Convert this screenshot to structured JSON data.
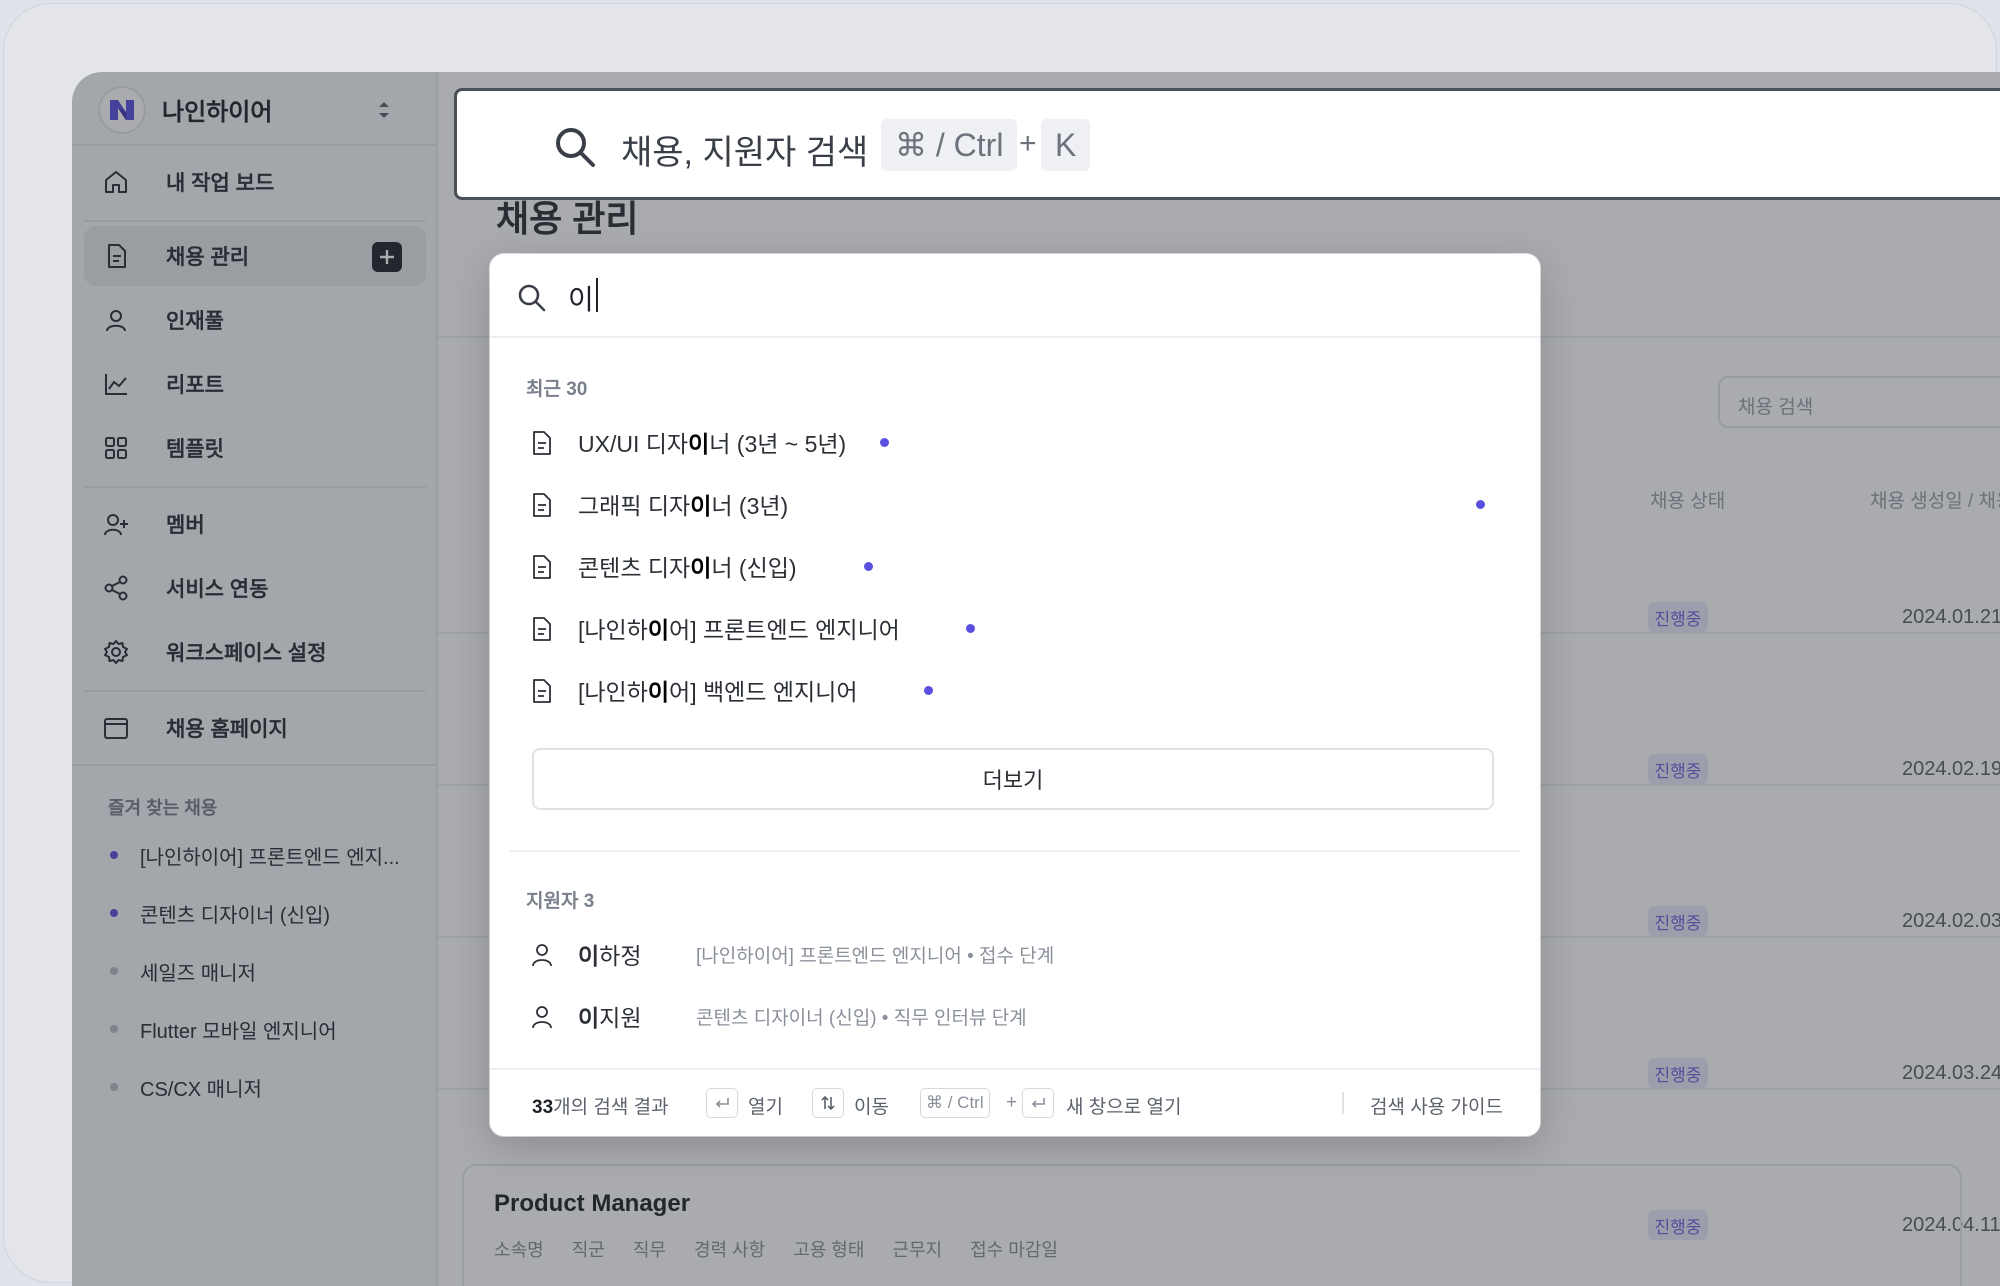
{
  "workspace": {
    "name": "나인하이어"
  },
  "sidebar": {
    "items": [
      {
        "label": "내 작업 보드",
        "icon": "home-icon"
      },
      {
        "label": "채용 관리",
        "icon": "document-icon"
      },
      {
        "label": "인재풀",
        "icon": "person-icon"
      },
      {
        "label": "리포트",
        "icon": "chart-icon"
      },
      {
        "label": "템플릿",
        "icon": "grid-icon"
      },
      {
        "label": "멤버",
        "icon": "add-user-icon"
      },
      {
        "label": "서비스 연동",
        "icon": "share-icon"
      },
      {
        "label": "워크스페이스 설정",
        "icon": "gear-icon"
      },
      {
        "label": "채용 홈페이지",
        "icon": "browser-icon"
      }
    ],
    "favorites_title": "즐겨 찾는 채용",
    "favorites": [
      {
        "label": "[나인하이어] 프론트엔드 엔지...",
        "color": "#5b4fe0"
      },
      {
        "label": "콘텐츠 디자이너 (신입)",
        "color": "#5b4fe0"
      },
      {
        "label": "세일즈 매니저",
        "color": "#b9bdc4"
      },
      {
        "label": "Flutter 모바일 엔지니어",
        "color": "#b9bdc4"
      },
      {
        "label": "CS/CX 매니저",
        "color": "#b9bdc4"
      }
    ]
  },
  "main": {
    "page_title": "채용 관리",
    "search_placeholder": "채용 검색",
    "columns": {
      "status": "채용 상태",
      "dates": "채용 생성일 / 채용 마감일"
    },
    "rows": [
      {
        "status": "진행중",
        "date": "2024.01.21"
      },
      {
        "status": "진행중",
        "date": "2024.02.19"
      },
      {
        "status": "진행중",
        "date": "2024.02.03"
      },
      {
        "status": "진행중",
        "date": "2024.03.24"
      },
      {
        "status": "진행중",
        "date": "2024.04.11"
      }
    ],
    "card": {
      "title": "Product Manager",
      "meta": [
        "소속명",
        "직군",
        "직무",
        "경력 사항",
        "고용 형태",
        "근무지",
        "접수 마감일"
      ]
    }
  },
  "search_bar": {
    "placeholder": "채용, 지원자 검색",
    "shortcut_mod": "⌘ / Ctrl",
    "shortcut_plus": "+",
    "shortcut_key": "K"
  },
  "modal": {
    "query": "이",
    "recent_title": "최근 30",
    "recent": [
      {
        "pre": "UX/UI 디자",
        "hl": "이",
        "post": "너 (3년 ~ 5년)"
      },
      {
        "pre": "그래픽 디자",
        "hl": "이",
        "post": "너 (3년)"
      },
      {
        "pre": "콘텐츠 디자",
        "hl": "이",
        "post": "너 (신입)"
      },
      {
        "pre": "[나인하",
        "hl": "이",
        "post": "어] 프론트엔드 엔지니어"
      },
      {
        "pre": "[나인하",
        "hl": "이",
        "post": "어] 백엔드 엔지니어"
      }
    ],
    "more_label": "더보기",
    "applicants_title": "지원자 3",
    "applicants": [
      {
        "hl": "이",
        "rest": "하정",
        "sub": "[나인하이어] 프론트엔드 엔지니어 • 접수 단계"
      },
      {
        "hl": "이",
        "rest": "지원",
        "sub": "콘텐츠 디자이너 (신입) • 직무 인터뷰 단계"
      }
    ],
    "footer": {
      "count": "33",
      "count_suffix": "개의 검색 결과",
      "open": "열기",
      "move": "이동",
      "mod": "⌘ / Ctrl",
      "plus": "+",
      "new_window": "새 창으로 열기",
      "guide": "검색 사용 가이드"
    },
    "accent_color": "#5b4fe0"
  }
}
